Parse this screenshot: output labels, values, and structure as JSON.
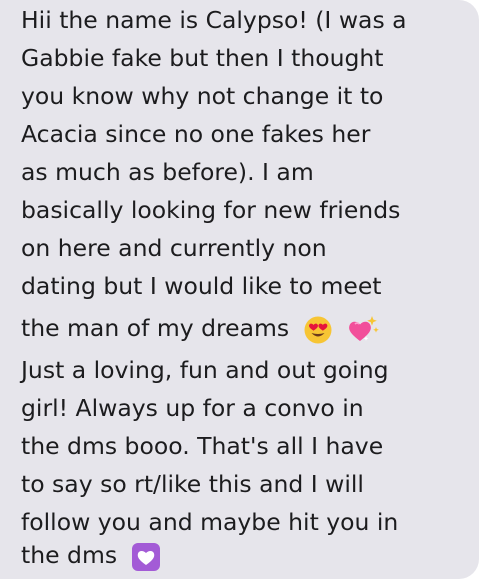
{
  "message": {
    "lines": [
      "Hii the name is Calypso! (I was a",
      "Gabbie fake but then I thought",
      "you know why not change it to",
      "Acacia since no one fakes her",
      "as much as before). I am",
      "basically looking for new friends",
      "on here and currently non",
      "dating but I would like to meet",
      "the man of my dreams",
      "Just a loving, fun and out going",
      "girl! Always up for a convo in",
      "the dms booo. That's all I have",
      "to say so rt/like this and I will",
      "follow you and maybe hit you in",
      "the dms"
    ],
    "emojis": [
      "heart-eyes-icon",
      "sparkling-heart-icon",
      "purple-heart-icon"
    ],
    "colors": {
      "bubble": "#e6e5eb",
      "text": "#1c1c1e",
      "purple_heart": "#a35bd6",
      "heart_pink": "#f24f9a",
      "face_yellow": "#f7c534"
    }
  }
}
